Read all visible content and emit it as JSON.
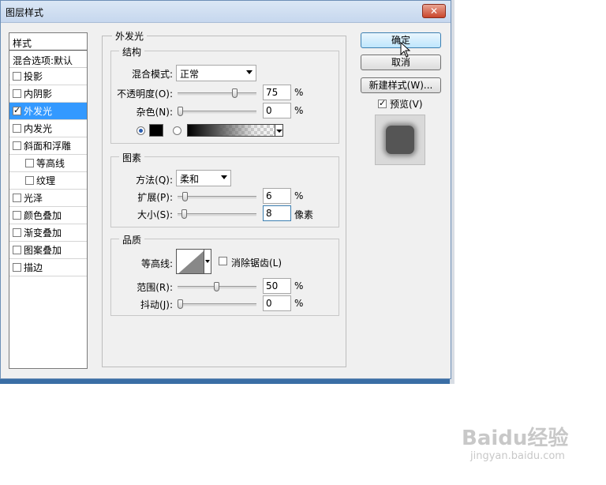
{
  "window": {
    "title": "图层样式",
    "close_label": "✕"
  },
  "styles_list": {
    "header": "样式",
    "blend_options": "混合选项:默认",
    "items": [
      {
        "label": "投影",
        "checked": false,
        "sub": false,
        "selected": false
      },
      {
        "label": "内阴影",
        "checked": false,
        "sub": false,
        "selected": false
      },
      {
        "label": "外发光",
        "checked": true,
        "sub": false,
        "selected": true
      },
      {
        "label": "内发光",
        "checked": false,
        "sub": false,
        "selected": false
      },
      {
        "label": "斜面和浮雕",
        "checked": false,
        "sub": false,
        "selected": false
      },
      {
        "label": "等高线",
        "checked": false,
        "sub": true,
        "selected": false
      },
      {
        "label": "纹理",
        "checked": false,
        "sub": true,
        "selected": false
      },
      {
        "label": "光泽",
        "checked": false,
        "sub": false,
        "selected": false
      },
      {
        "label": "颜色叠加",
        "checked": false,
        "sub": false,
        "selected": false
      },
      {
        "label": "渐变叠加",
        "checked": false,
        "sub": false,
        "selected": false
      },
      {
        "label": "图案叠加",
        "checked": false,
        "sub": false,
        "selected": false
      },
      {
        "label": "描边",
        "checked": false,
        "sub": false,
        "selected": false
      }
    ]
  },
  "outer_glow": {
    "title": "外发光",
    "structure": {
      "title": "结构",
      "blend_mode_label": "混合模式:",
      "blend_mode_value": "正常",
      "opacity_label": "不透明度(O):",
      "opacity_value": "75",
      "opacity_level": 75,
      "noise_label": "杂色(N):",
      "noise_value": "0",
      "noise_level": 0,
      "unit_percent": "%"
    },
    "elements": {
      "title": "图素",
      "technique_label": "方法(Q):",
      "technique_value": "柔和",
      "spread_label": "扩展(P):",
      "spread_value": "6",
      "spread_level": 6,
      "size_label": "大小(S):",
      "size_value": "8",
      "size_unit": "像素",
      "unit_percent": "%"
    },
    "quality": {
      "title": "品质",
      "contour_label": "等高线:",
      "antialias_label": "消除锯齿(L)",
      "range_label": "范围(R):",
      "range_value": "50",
      "range_level": 50,
      "jitter_label": "抖动(J):",
      "jitter_value": "0",
      "jitter_level": 0,
      "unit_percent": "%"
    }
  },
  "buttons": {
    "ok": "确定",
    "cancel": "取消",
    "new_style": "新建样式(W)...",
    "preview_label": "预览(V)",
    "preview_checked": true
  },
  "watermark": {
    "brand": "Baidu经验",
    "url": "jingyan.baidu.com"
  },
  "colors": {
    "selection": "#3399ff",
    "glow_color": "#000000"
  }
}
